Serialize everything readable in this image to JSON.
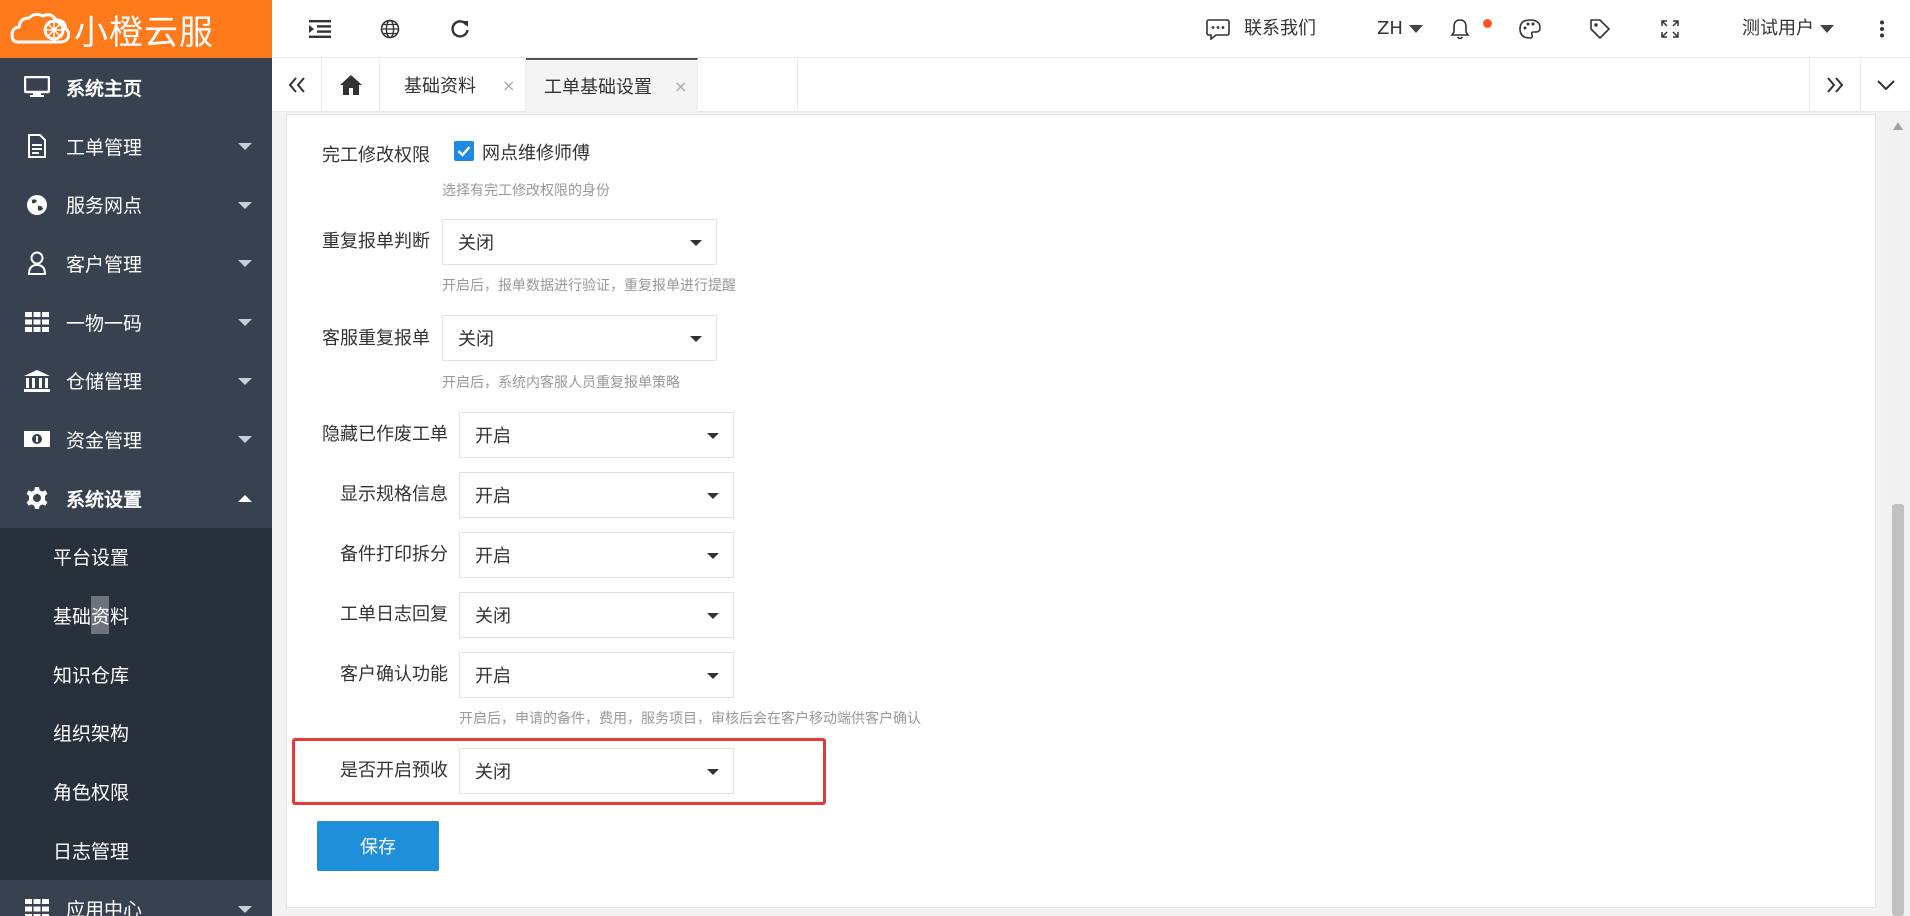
{
  "brand": {
    "name": "小橙云服",
    "color": "#ff7a1a"
  },
  "sidebar": {
    "items": [
      {
        "label": "系统主页",
        "icon": "monitor-icon"
      },
      {
        "label": "工单管理",
        "icon": "document-icon"
      },
      {
        "label": "服务网点",
        "icon": "globe-icon"
      },
      {
        "label": "客户管理",
        "icon": "user-icon"
      },
      {
        "label": "一物一码",
        "icon": "grid-icon"
      },
      {
        "label": "仓储管理",
        "icon": "bank-icon"
      },
      {
        "label": "资金管理",
        "icon": "money-icon"
      },
      {
        "label": "系统设置",
        "icon": "gear-icon"
      }
    ],
    "submenu": [
      "平台设置",
      "基础资料",
      "知识仓库",
      "组织架构",
      "角色权限",
      "日志管理"
    ],
    "bottom_item": {
      "label": "应用中心",
      "icon": "grid-icon"
    }
  },
  "header": {
    "contact": "联系我们",
    "lang": "ZH",
    "user": "测试用户"
  },
  "tabs": [
    {
      "label": "基础资料",
      "close": "×"
    },
    {
      "label": "工单基础设置",
      "close": "×"
    }
  ],
  "form": {
    "completion_permission": {
      "label": "完工修改权限",
      "checkbox_label": "网点维修师傅",
      "checked": true,
      "hint": "选择有完工修改权限的身份"
    },
    "fields": [
      {
        "label": "重复报单判断",
        "value": "关闭",
        "hint": "开启后，报单数据进行验证，重复报单进行提醒"
      },
      {
        "label": "客服重复报单",
        "value": "关闭",
        "hint": "开启后，系统内客服人员重复报单策略"
      },
      {
        "label": "隐藏已作废工单",
        "value": "开启",
        "hint": ""
      },
      {
        "label": "显示规格信息",
        "value": "开启",
        "hint": ""
      },
      {
        "label": "备件打印拆分",
        "value": "开启",
        "hint": ""
      },
      {
        "label": "工单日志回复",
        "value": "关闭",
        "hint": ""
      },
      {
        "label": "客户确认功能",
        "value": "开启",
        "hint": "开启后，申请的备件，费用，服务项目，审核后会在客户移动端供客户确认"
      },
      {
        "label": "是否开启预收",
        "value": "关闭",
        "hint": ""
      }
    ],
    "save_label": "保存"
  },
  "colors": {
    "sidebar_bg": "#37414f",
    "submenu_bg": "#28303c",
    "primary": "#1e8fd8",
    "highlight_border": "#e53935",
    "notification_dot": "#ff5722"
  }
}
